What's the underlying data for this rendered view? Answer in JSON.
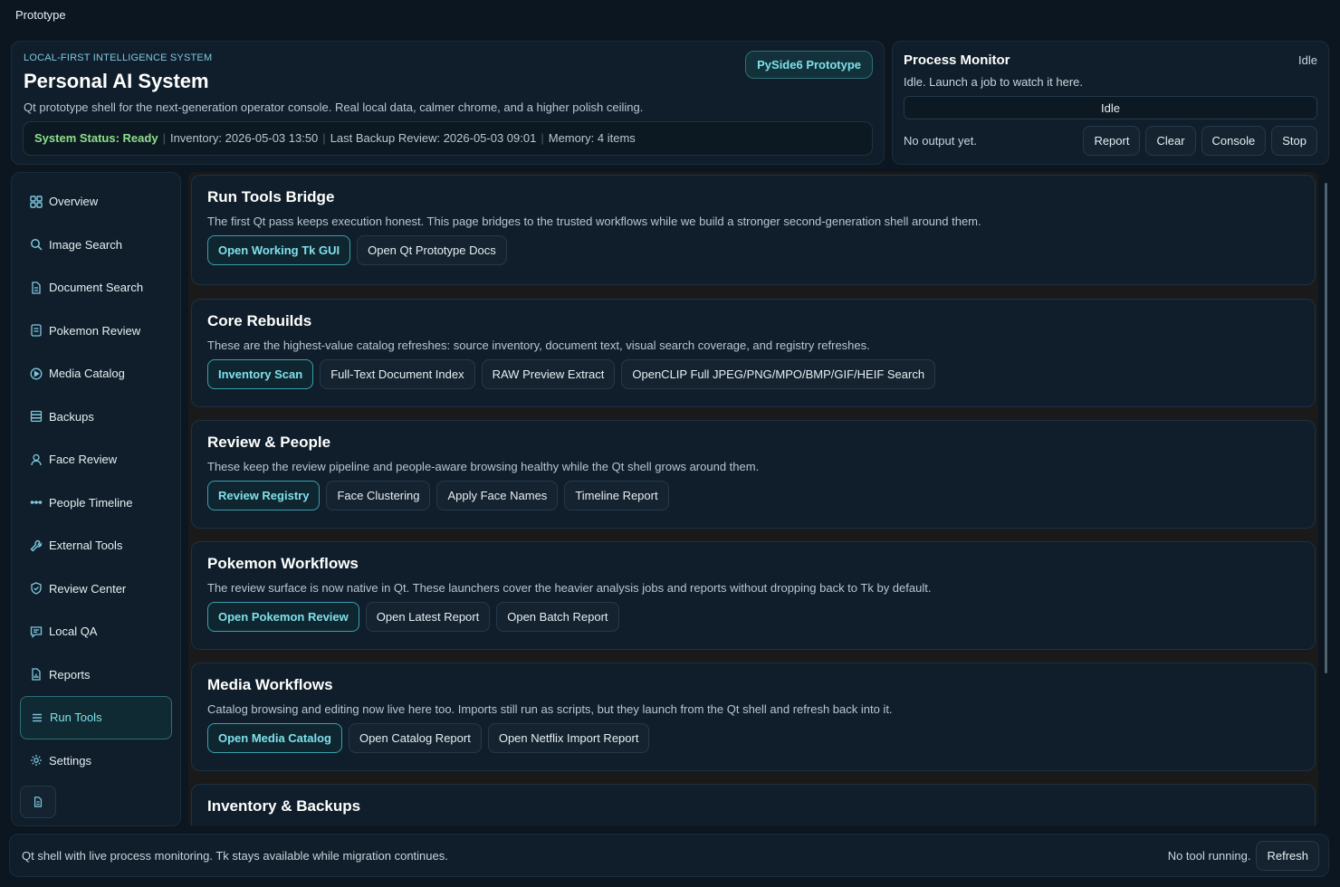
{
  "window": {
    "title": "Prototype"
  },
  "header": {
    "eyebrow": "LOCAL-FIRST INTELLIGENCE SYSTEM",
    "title": "Personal AI System",
    "subtitle": "Qt prototype shell for the next-generation operator console. Real local data, calmer chrome, and a higher polish ceiling.",
    "badge": "PySide6 Prototype",
    "status": {
      "system": "System Status: Ready",
      "inventory": "Inventory: 2026-05-03 13:50",
      "backup": "Last Backup Review: 2026-05-03 09:01",
      "memory": "Memory: 4 items",
      "separator": "|"
    }
  },
  "monitor": {
    "title": "Process Monitor",
    "state": "Idle",
    "subtitle": "Idle. Launch a job to watch it here.",
    "bar_text": "Idle",
    "output": "No output yet.",
    "buttons": [
      "Report",
      "Clear",
      "Console",
      "Stop"
    ]
  },
  "sidebar": {
    "items": [
      {
        "label": "Overview",
        "icon": "grid-icon"
      },
      {
        "label": "Image Search",
        "icon": "search-icon"
      },
      {
        "label": "Document Search",
        "icon": "document-icon"
      },
      {
        "label": "Pokemon Review",
        "icon": "card-icon"
      },
      {
        "label": "Media Catalog",
        "icon": "play-icon"
      },
      {
        "label": "Backups",
        "icon": "database-icon"
      },
      {
        "label": "Face Review",
        "icon": "person-icon"
      },
      {
        "label": "People Timeline",
        "icon": "timeline-icon"
      },
      {
        "label": "External Tools",
        "icon": "wrench-icon"
      },
      {
        "label": "Review Center",
        "icon": "shield-icon"
      },
      {
        "label": "Local QA",
        "icon": "chat-icon"
      },
      {
        "label": "Reports",
        "icon": "report-icon"
      },
      {
        "label": "Run Tools",
        "icon": "menu-icon"
      },
      {
        "label": "Settings",
        "icon": "gear-icon"
      }
    ],
    "active": "Run Tools"
  },
  "cards": [
    {
      "title": "Run Tools Bridge",
      "desc": "The first Qt pass keeps execution honest. This page bridges to the trusted workflows while we build a stronger second-generation shell around them.",
      "buttons": [
        "Open Working Tk GUI",
        "Open Qt Prototype Docs"
      ]
    },
    {
      "title": "Core Rebuilds",
      "desc": "These are the highest-value catalog refreshes: source inventory, document text, visual search coverage, and registry refreshes.",
      "buttons": [
        "Inventory Scan",
        "Full-Text Document Index",
        "RAW Preview Extract",
        "OpenCLIP Full JPEG/PNG/MPO/BMP/GIF/HEIF Search"
      ]
    },
    {
      "title": "Review & People",
      "desc": "These keep the review pipeline and people-aware browsing healthy while the Qt shell grows around them.",
      "buttons": [
        "Review Registry",
        "Face Clustering",
        "Apply Face Names",
        "Timeline Report"
      ]
    },
    {
      "title": "Pokemon Workflows",
      "desc": "The review surface is now native in Qt. These launchers cover the heavier analysis jobs and reports without dropping back to Tk by default.",
      "buttons": [
        "Open Pokemon Review",
        "Open Latest Report",
        "Open Batch Report"
      ]
    },
    {
      "title": "Media Workflows",
      "desc": "Catalog browsing and editing now live here too. Imports still run as scripts, but they launch from the Qt shell and refresh back into it.",
      "buttons": [
        "Open Media Catalog",
        "Open Catalog Report",
        "Open Netflix Import Report"
      ]
    },
    {
      "title": "Inventory & Backups",
      "desc": "",
      "buttons": []
    }
  ],
  "footer": {
    "text": "Qt shell with live process monitoring. Tk stays available while migration continues.",
    "status": "No tool running.",
    "refresh": "Refresh"
  },
  "colors": {
    "background": "#0b1620",
    "panel": "#0f1e2a",
    "accent": "#7fe0ea",
    "ready": "#8ee08a"
  }
}
